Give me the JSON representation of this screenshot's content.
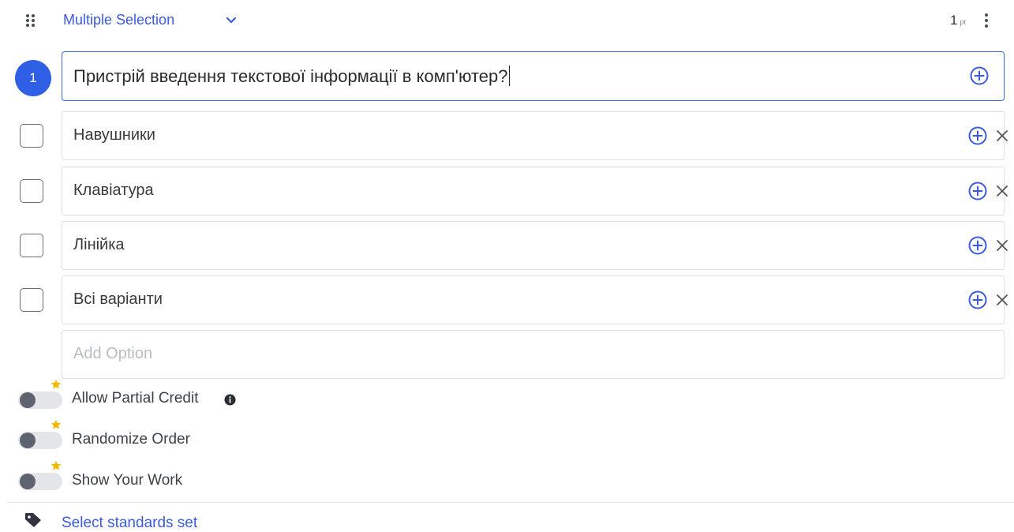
{
  "header": {
    "question_type": "Multiple Selection",
    "points_value": "1",
    "points_unit": "pt"
  },
  "question": {
    "number": "1",
    "text": "Пристрій введення текстової інформації в комп'ютер?"
  },
  "options": [
    {
      "label": "Навушники",
      "checked": false
    },
    {
      "label": "Клавіатура",
      "checked": false
    },
    {
      "label": "Лінійка",
      "checked": false
    },
    {
      "label": "Всі варіанти",
      "checked": false
    }
  ],
  "add_option": {
    "placeholder": "Add Option"
  },
  "settings": {
    "partial_credit": {
      "label": "Allow Partial Credit",
      "on": false
    },
    "randomize_order": {
      "label": "Randomize Order",
      "on": false
    },
    "show_work": {
      "label": "Show Your Work",
      "on": false
    }
  },
  "standards": {
    "link_label": "Select standards set"
  },
  "colors": {
    "accent": "#3b5bdb",
    "badge": "#2f5fe5",
    "premium_star": "#f5b800"
  }
}
